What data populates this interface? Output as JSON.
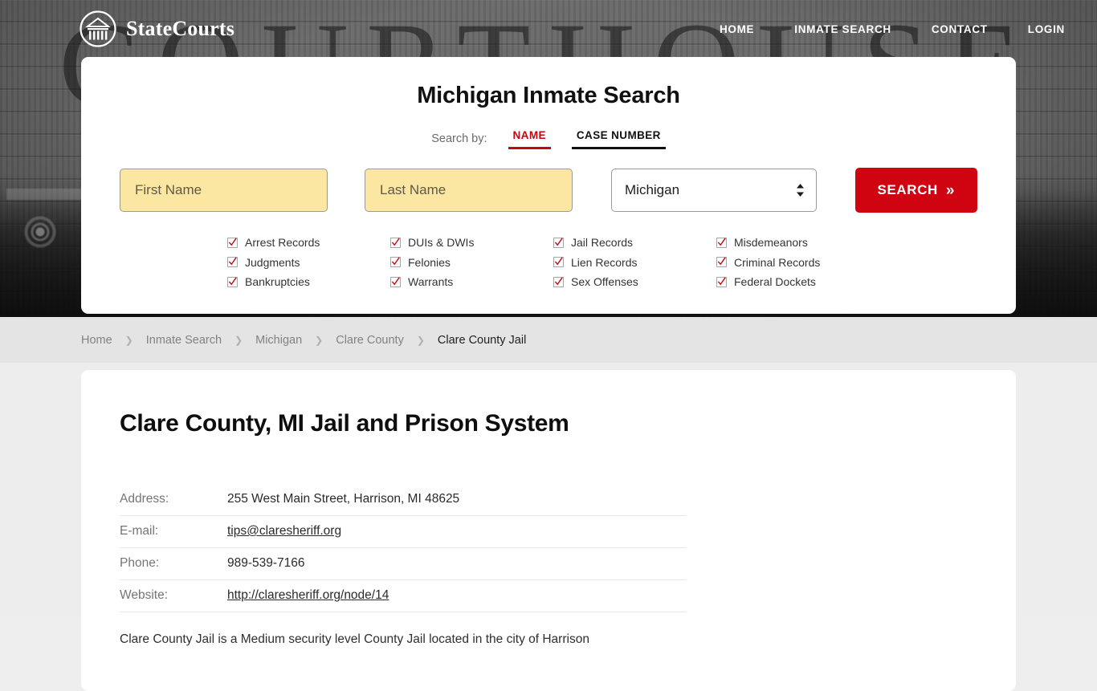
{
  "brand": {
    "name": "StateCourts",
    "logo_icon": "courthouse-circle-icon"
  },
  "nav": {
    "items": [
      {
        "label": "HOME"
      },
      {
        "label": "INMATE SEARCH"
      },
      {
        "label": "CONTACT"
      },
      {
        "label": "LOGIN"
      }
    ]
  },
  "hero": {
    "background_word": "COURTHOUSE"
  },
  "search_panel": {
    "title": "Michigan Inmate Search",
    "search_by_label": "Search by:",
    "tabs": [
      {
        "label": "NAME",
        "active": true
      },
      {
        "label": "CASE NUMBER",
        "active": false
      }
    ],
    "first_name": {
      "value": "",
      "placeholder": "First Name"
    },
    "last_name": {
      "value": "",
      "placeholder": "Last Name"
    },
    "state_select": {
      "value": "Michigan"
    },
    "search_button": {
      "label": "SEARCH",
      "chevron": "»"
    },
    "accent_red": "#c1070f",
    "button_red": "#d00310",
    "field_yellow": "#fbe6a2",
    "categories": [
      [
        "Arrest Records",
        "Judgments",
        "Bankruptcies"
      ],
      [
        "DUIs & DWIs",
        "Felonies",
        "Warrants"
      ],
      [
        "Jail Records",
        "Lien Records",
        "Sex Offenses"
      ],
      [
        "Misdemeanors",
        "Criminal Records",
        "Federal Dockets"
      ]
    ]
  },
  "breadcrumb": {
    "separator": "❯",
    "items": [
      {
        "label": "Home",
        "current": false
      },
      {
        "label": "Inmate Search",
        "current": false
      },
      {
        "label": "Michigan",
        "current": false
      },
      {
        "label": "Clare County",
        "current": false
      },
      {
        "label": "Clare County Jail",
        "current": true
      }
    ]
  },
  "main": {
    "page_title": "Clare County, MI Jail and Prison System",
    "info_rows": [
      {
        "label": "Address:",
        "value": "255 West Main Street, Harrison, MI 48625",
        "link": false
      },
      {
        "label": "E-mail:",
        "value": "tips@claresheriff.org",
        "link": true
      },
      {
        "label": "Phone:",
        "value": "989-539-7166",
        "link": false
      },
      {
        "label": "Website:",
        "value": "http://claresheriff.org/node/14",
        "link": true
      }
    ],
    "body_text": "Clare County Jail is a Medium security level County Jail located in the city of Harrison"
  }
}
